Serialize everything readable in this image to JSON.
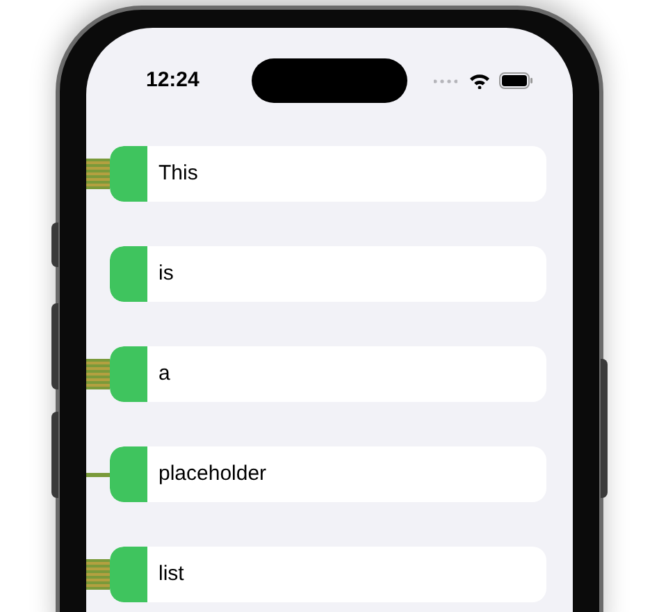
{
  "status_bar": {
    "time": "12:24"
  },
  "rows": [
    {
      "label": "This",
      "kind": "thick"
    },
    {
      "label": "is",
      "kind": "none"
    },
    {
      "label": "a",
      "kind": "thick"
    },
    {
      "label": "placeholder",
      "kind": "thin"
    },
    {
      "label": "list",
      "kind": "thick"
    }
  ]
}
